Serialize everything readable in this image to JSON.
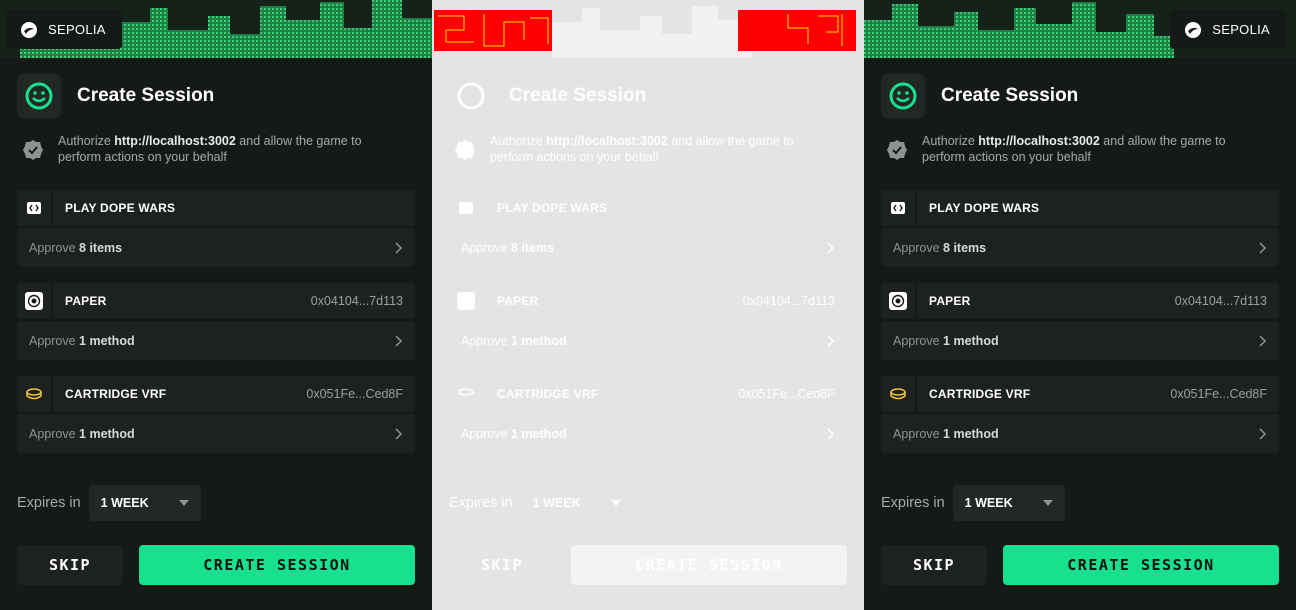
{
  "network": {
    "label": "SEPOLIA",
    "icon": "starknet-icon"
  },
  "session": {
    "title": "Create Session",
    "authorize_prefix": "Authorize ",
    "authorize_host": "http://localhost:3002",
    "authorize_suffix": " and allow the game to perform actions on your behalf"
  },
  "cards": [
    {
      "name": "PLAY DOPE WARS",
      "address": "",
      "icon": "code-icon",
      "approve_prefix": "Approve ",
      "approve_count": "8 items"
    },
    {
      "name": "PAPER",
      "address": "0x04104...7d113",
      "icon": "paper-token-icon",
      "approve_prefix": "Approve ",
      "approve_count": "1 method"
    },
    {
      "name": "CARTRIDGE VRF",
      "address": "0x051Fe...Ced8F",
      "icon": "vrf-coin-icon",
      "approve_prefix": "Approve ",
      "approve_count": "1 method"
    }
  ],
  "expires": {
    "label": "Expires in",
    "value": "1 WEEK"
  },
  "buttons": {
    "skip": "SKIP",
    "create": "CREATE SESSION"
  },
  "colors": {
    "accent": "#17e08f",
    "background": "#161a17",
    "card": "#1d221e",
    "vrf": "#f5c542",
    "redacted": "#ff0000"
  }
}
